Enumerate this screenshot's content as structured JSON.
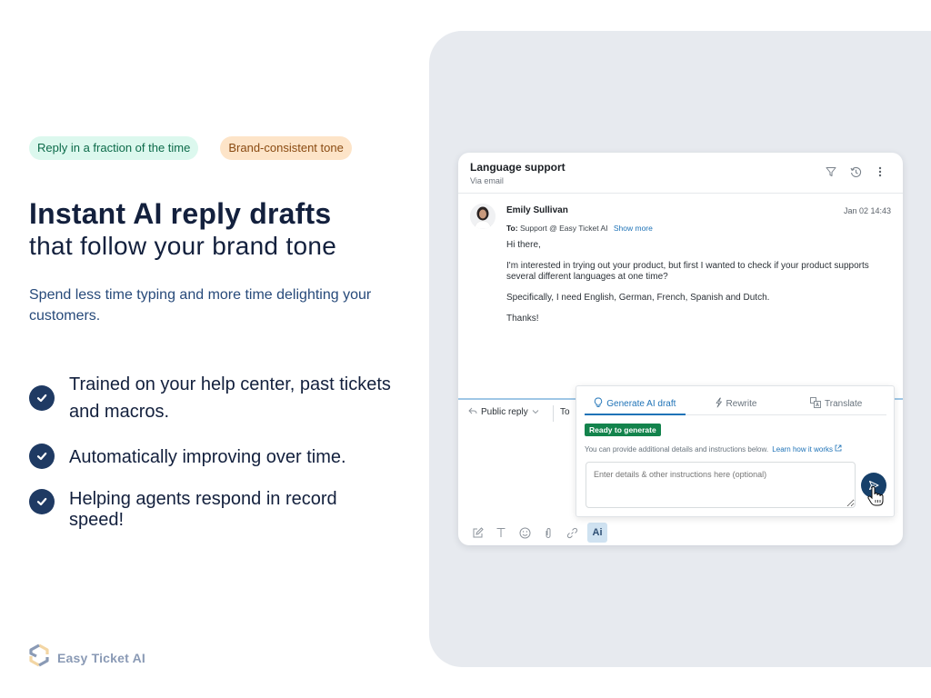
{
  "tags": [
    {
      "label": "Reply in a fraction of the time",
      "color": "#0d6b4a",
      "bg": "#dcf8ee"
    },
    {
      "label": "Brand-consistent tone",
      "color": "#8a4b12",
      "bg": "#fde4c8"
    }
  ],
  "headline": {
    "title": "Instant AI reply drafts",
    "subtitle": "that follow your brand tone"
  },
  "description": "Spend less time typing and more time delighting your customers.",
  "features": [
    {
      "icon": "check-circle-icon",
      "text": "Trained on your help center, past tickets and macros."
    },
    {
      "icon": "check-circle-icon",
      "text": "Automatically improving over time."
    },
    {
      "icon": "check-circle-icon",
      "text": "Helping agents respond in record speed!"
    }
  ],
  "brand": {
    "name": "Easy Ticket AI"
  },
  "ticket": {
    "title": "Language support",
    "channel": "Via email",
    "header_icons": [
      "filter-icon",
      "history-icon",
      "more-vertical-icon"
    ],
    "message": {
      "sender": "Emily Sullivan",
      "timestamp": "Jan 02 14:43",
      "to_label": "To:",
      "to_value": "Support @ Easy Ticket AI",
      "show_more": "Show more",
      "paragraphs": [
        "Hi there,",
        "I'm interested in trying out your product, but first I wanted to check if your product supports several different languages at one time?",
        "Specifically, I need English, German, French, Spanish and Dutch.",
        "Thanks!"
      ]
    },
    "reply": {
      "type_label": "Public reply",
      "to_label": "To"
    },
    "toolbar": [
      {
        "icon": "compose-icon",
        "label": "Compose"
      },
      {
        "icon": "text-format-icon",
        "label": "T"
      },
      {
        "icon": "emoji-icon",
        "label": "Emoji"
      },
      {
        "icon": "attachment-icon",
        "label": "Attach"
      },
      {
        "icon": "link-icon",
        "label": "Link"
      },
      {
        "icon": "ai-icon",
        "label": "Ai"
      }
    ]
  },
  "ai_panel": {
    "tabs": [
      {
        "label": "Generate AI draft",
        "icon": "lightbulb-icon",
        "active": true
      },
      {
        "label": "Rewrite",
        "icon": "lightning-icon",
        "active": false
      },
      {
        "label": "Translate",
        "icon": "translate-icon",
        "active": false
      }
    ],
    "status": "Ready to generate",
    "hint": "You can provide additional details and instructions below.",
    "learn_link": "Learn how it works",
    "input_placeholder": "Enter details & other instructions here (optional)",
    "input_value": ""
  }
}
